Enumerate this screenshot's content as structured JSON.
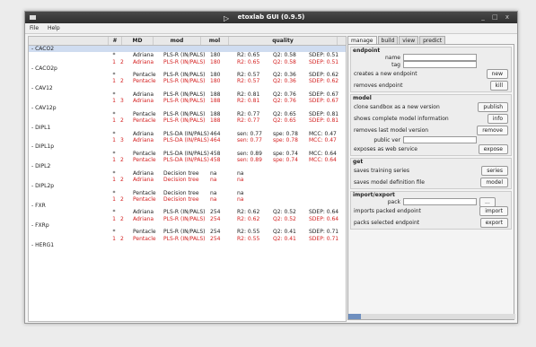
{
  "window": {
    "title": "etoxlab GUI (0.9.5)",
    "controls": "_ □ x"
  },
  "menubar": [
    "File",
    "Help"
  ],
  "table": {
    "headers": [
      "",
      "#",
      "MD",
      "mod",
      "mol",
      "quality"
    ],
    "rows": [
      {
        "type": "ep",
        "label": "CACO2",
        "sel": true
      },
      {
        "type": "v",
        "n1": "*",
        "n2": "",
        "md": "Adriana",
        "mod": "PLS-R (IN/PALS)",
        "mol": "180",
        "q": [
          "R2: 0.65",
          "Q2: 0.58",
          "SDEP: 0.51"
        ],
        "red": false
      },
      {
        "type": "v",
        "n1": "1",
        "n2": "2",
        "md": "Adriana",
        "mod": "PLS-R (IN/PALS)",
        "mol": "180",
        "q": [
          "R2: 0.65",
          "Q2: 0.58",
          "SDEP: 0.51"
        ],
        "red": true
      },
      {
        "type": "ep",
        "label": "CACO2p"
      },
      {
        "type": "v",
        "n1": "*",
        "n2": "",
        "md": "Pentacle",
        "mod": "PLS-R (IN/PALS)",
        "mol": "180",
        "q": [
          "R2: 0.57",
          "Q2: 0.36",
          "SDEP: 0.62"
        ],
        "red": false
      },
      {
        "type": "v",
        "n1": "1",
        "n2": "2",
        "md": "Pentacle",
        "mod": "PLS-R (IN/PALS)",
        "mol": "180",
        "q": [
          "R2: 0.57",
          "Q2: 0.36",
          "SDEP: 0.62"
        ],
        "red": true
      },
      {
        "type": "ep",
        "label": "CAV12"
      },
      {
        "type": "v",
        "n1": "*",
        "n2": "",
        "md": "Adriana",
        "mod": "PLS-R (IN/PALS)",
        "mol": "188",
        "q": [
          "R2: 0.81",
          "Q2: 0.76",
          "SDEP: 0.67"
        ],
        "red": false
      },
      {
        "type": "v",
        "n1": "1",
        "n2": "3",
        "md": "Adriana",
        "mod": "PLS-R (IN/PALS)",
        "mol": "188",
        "q": [
          "R2: 0.81",
          "Q2: 0.76",
          "SDEP: 0.67"
        ],
        "red": true
      },
      {
        "type": "ep",
        "label": "CAV12p"
      },
      {
        "type": "v",
        "n1": "*",
        "n2": "",
        "md": "Pentacle",
        "mod": "PLS-R (IN/PALS)",
        "mol": "188",
        "q": [
          "R2: 0.77",
          "Q2: 0.65",
          "SDEP: 0.81"
        ],
        "red": false
      },
      {
        "type": "v",
        "n1": "1",
        "n2": "2",
        "md": "Pentacle",
        "mod": "PLS-R (IN/PALS)",
        "mol": "188",
        "q": [
          "R2: 0.77",
          "Q2: 0.65",
          "SDEP: 0.81"
        ],
        "red": true
      },
      {
        "type": "ep",
        "label": "DIPL1"
      },
      {
        "type": "v",
        "n1": "*",
        "n2": "",
        "md": "Adriana",
        "mod": "PLS-DA (IN/PALS)",
        "mol": "464",
        "q": [
          "sen: 0.77",
          "spe: 0.78",
          "MCC: 0.47"
        ],
        "red": false
      },
      {
        "type": "v",
        "n1": "1",
        "n2": "3",
        "md": "Adriana",
        "mod": "PLS-DA (IN/PALS)",
        "mol": "464",
        "q": [
          "sen: 0.77",
          "spe: 0.78",
          "MCC: 0.47"
        ],
        "red": true
      },
      {
        "type": "ep",
        "label": "DIPL1p"
      },
      {
        "type": "v",
        "n1": "*",
        "n2": "",
        "md": "Pentacle",
        "mod": "PLS-DA (IN/PALS)",
        "mol": "458",
        "q": [
          "sen: 0.89",
          "spe: 0.74",
          "MCC: 0.64"
        ],
        "red": false
      },
      {
        "type": "v",
        "n1": "1",
        "n2": "2",
        "md": "Pentacle",
        "mod": "PLS-DA (IN/PALS)",
        "mol": "458",
        "q": [
          "sen: 0.89",
          "spe: 0.74",
          "MCC: 0.64"
        ],
        "red": true
      },
      {
        "type": "ep",
        "label": "DIPL2"
      },
      {
        "type": "v",
        "n1": "*",
        "n2": "",
        "md": "Adriana",
        "mod": "Decision tree",
        "mol": "na",
        "q": [
          "na",
          "",
          ""
        ],
        "red": false
      },
      {
        "type": "v",
        "n1": "1",
        "n2": "2",
        "md": "Adriana",
        "mod": "Decision tree",
        "mol": "na",
        "q": [
          "na",
          "",
          ""
        ],
        "red": true
      },
      {
        "type": "ep",
        "label": "DIPL2p"
      },
      {
        "type": "v",
        "n1": "*",
        "n2": "",
        "md": "Pentacle",
        "mod": "Decision tree",
        "mol": "na",
        "q": [
          "na",
          "",
          ""
        ],
        "red": false
      },
      {
        "type": "v",
        "n1": "1",
        "n2": "2",
        "md": "Pentacle",
        "mod": "Decision tree",
        "mol": "na",
        "q": [
          "na",
          "",
          ""
        ],
        "red": true
      },
      {
        "type": "ep",
        "label": "FXR"
      },
      {
        "type": "v",
        "n1": "*",
        "n2": "",
        "md": "Adriana",
        "mod": "PLS-R (IN/PALS)",
        "mol": "254",
        "q": [
          "R2: 0.62",
          "Q2: 0.52",
          "SDEP: 0.64"
        ],
        "red": false
      },
      {
        "type": "v",
        "n1": "1",
        "n2": "2",
        "md": "Adriana",
        "mod": "PLS-R (IN/PALS)",
        "mol": "254",
        "q": [
          "R2: 0.62",
          "Q2: 0.52",
          "SDEP: 0.64"
        ],
        "red": true
      },
      {
        "type": "ep",
        "label": "FXRp"
      },
      {
        "type": "v",
        "n1": "*",
        "n2": "",
        "md": "Pentacle",
        "mod": "PLS-R (IN/PALS)",
        "mol": "254",
        "q": [
          "R2: 0.55",
          "Q2: 0.41",
          "SDEP: 0.71"
        ],
        "red": false
      },
      {
        "type": "v",
        "n1": "1",
        "n2": "2",
        "md": "Pentacle",
        "mod": "PLS-R (IN/PALS)",
        "mol": "254",
        "q": [
          "R2: 0.55",
          "Q2: 0.41",
          "SDEP: 0.71"
        ],
        "red": true
      },
      {
        "type": "ep",
        "label": "HERG1"
      }
    ]
  },
  "right": {
    "tabs": [
      "manage",
      "build",
      "view",
      "predict"
    ],
    "endpoint": {
      "title": "endpoint",
      "name_label": "name",
      "tag_label": "tag",
      "create_text": "creates a new endpoint",
      "new_btn": "new",
      "remove_text": "removes endpoint",
      "kill_btn": "kill"
    },
    "model": {
      "title": "model",
      "clone_text": "clone sandbox as a new version",
      "publish_btn": "publish",
      "info_text": "shows complete model information",
      "info_btn": "info",
      "rm_text": "removes last model version",
      "remove_btn": "remove",
      "pubver_label": "public ver",
      "expose_text": "exposes as web service",
      "expose_btn": "expose"
    },
    "get": {
      "title": "get",
      "series_text": "saves training series",
      "series_btn": "series",
      "model_text": "saves model definition file",
      "model_btn": "model"
    },
    "impexp": {
      "title": "import/export",
      "pack_label": "pack",
      "browse_btn": "...",
      "import_text": "imports packed endpoint",
      "import_btn": "import",
      "export_text": "packs selected endpoint",
      "export_btn": "export"
    }
  }
}
